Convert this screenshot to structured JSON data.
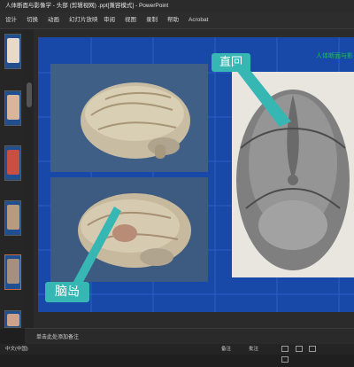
{
  "window": {
    "title": "人体断面与影像学 - 头部 (剪辑视网) .ppt[兼容模式] - PowerPoint"
  },
  "ribbon": {
    "tabs": [
      "设计",
      "切换",
      "动画",
      "幻灯片放映",
      "审阅",
      "视图",
      "录制",
      "帮助",
      "Acrobat"
    ]
  },
  "thumbnails": {
    "numbers": [
      "",
      "",
      "",
      "",
      "",
      ""
    ]
  },
  "slide": {
    "header": "人体断面与影",
    "label_top": "直回",
    "label_bottom": "脑岛",
    "colors": {
      "background": "#1849a8",
      "label_bg": "#36b7b4",
      "header_text": "#19c24a"
    }
  },
  "notes": {
    "placeholder": "单击此处添加备注"
  },
  "status": {
    "language": "中文(中国)",
    "notes_button": "备注",
    "comments_button": "批注"
  }
}
